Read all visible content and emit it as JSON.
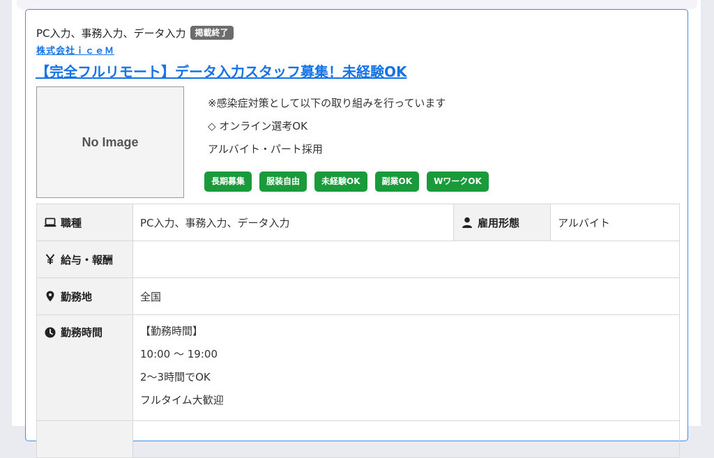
{
  "listing": {
    "category": "PC入力、事務入力、データ入力",
    "status_badge": "掲載終了",
    "company": "株式会社ｉｃｅＭ",
    "title": "【完全フルリモート】データ入力スタッフ募集！未経験OK",
    "image_placeholder": "No Image",
    "intro_lines": [
      "※感染症対策として以下の取り組みを行っています",
      "◇ オンライン選考OK",
      "アルバイト・パート採用"
    ],
    "tags": [
      "長期募集",
      "服装自由",
      "未経験OK",
      "副業OK",
      "WワークOK"
    ]
  },
  "details": {
    "job_type_label": "職種",
    "job_type_value": "PC入力、事務入力、データ入力",
    "employment_label": "雇用形態",
    "employment_value": "アルバイト",
    "salary_label": "給与・報酬",
    "salary_value": "",
    "location_label": "勤務地",
    "location_value": "全国",
    "hours_label": "勤務時間",
    "hours_lines": [
      "【勤務時間】",
      "10:00 ～ 19:00",
      "2～3時間でOK",
      "フルタイム大歓迎"
    ]
  },
  "colors": {
    "link": "#1673e6",
    "tag_green": "#1a9a3a",
    "badge_gray": "#6c6c6c",
    "card_border": "#3b8fe6"
  },
  "icons": [
    "laptop-icon",
    "person-icon",
    "yen-icon",
    "map-pin-icon",
    "clock-icon"
  ]
}
